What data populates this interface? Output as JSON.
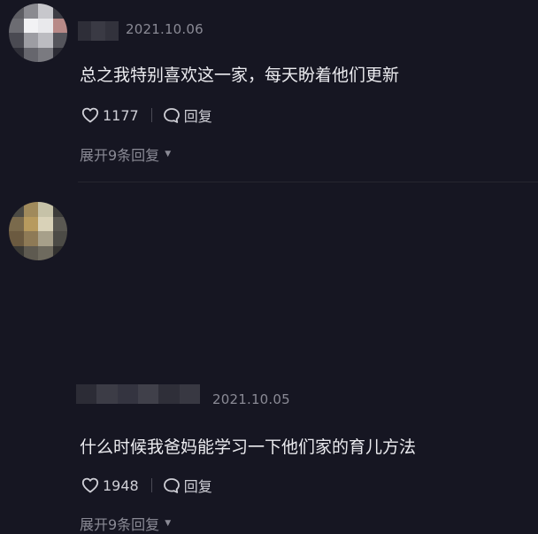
{
  "comments": [
    {
      "date": "2021.10.06",
      "text": "总之我特别喜欢这一家，每天盼着他们更新",
      "likes": "1177",
      "reply_label": "回复",
      "expand_label": "展开9条回复",
      "avatar_colors": [
        "#5d5d63",
        "#8a8a90",
        "#c7c7cc",
        "#3d3d45",
        "#6c6c72",
        "#f2f2f4",
        "#e9e9ec",
        "#b88a88",
        "#4a4a52",
        "#9d9da3",
        "#bcbcc1",
        "#55555c",
        "#2f2f38",
        "#66666d",
        "#7a7a80",
        "#2c2c35"
      ]
    },
    {
      "date": "2021.10.05",
      "text": "什么时候我爸妈能学习一下他们家的育儿方法",
      "likes": "1948",
      "reply_label": "回复",
      "expand_label": "展开9条回复",
      "avatar_colors": [
        "#4b4a44",
        "#a08a5c",
        "#c6c2a8",
        "#3c3c3a",
        "#7a6a4c",
        "#b79a5e",
        "#d9d2b8",
        "#5a5852",
        "#6b5a40",
        "#8e7a56",
        "#a7a08a",
        "#4c4b46",
        "#3a3935",
        "#5e5a50",
        "#6e6a5e",
        "#333230"
      ]
    }
  ]
}
